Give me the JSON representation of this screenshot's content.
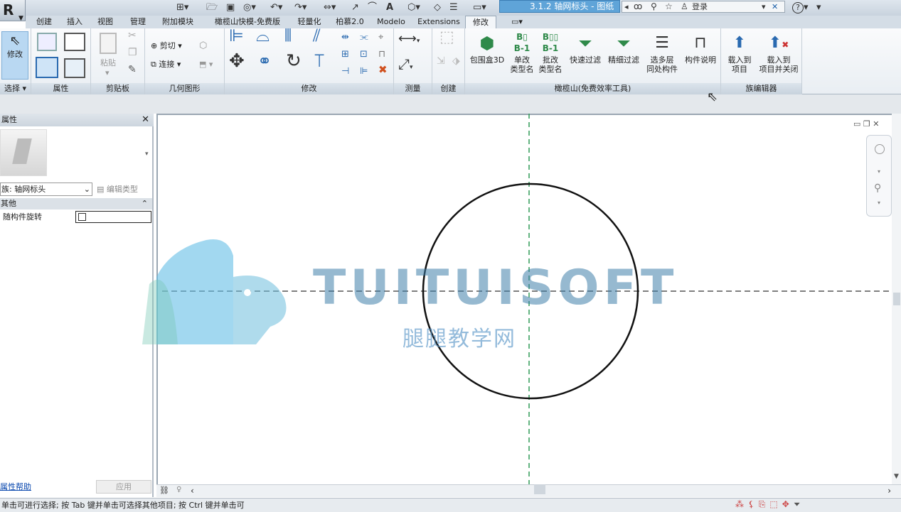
{
  "titlebar": {
    "app_icon": "revit-logo-icon",
    "app_letter": "R",
    "document_title": "3.1.2 轴网标头 - 图纸",
    "account_label": "登录",
    "help_label": "?"
  },
  "tabs": [
    "创建",
    "插入",
    "视图",
    "管理",
    "附加模块",
    "橄榄山快模-免费版",
    "轻量化",
    "柏慕2.0",
    "Modelo",
    "Extensions",
    "修改"
  ],
  "active_tab": "修改",
  "ribbon": {
    "panels": {
      "select": "选择",
      "properties": "属性",
      "clipboard": "剪贴板",
      "geometry": "几何图形",
      "modify": "修改",
      "measure": "测量",
      "create": "创建",
      "olivemountain": "橄榄山(免费效率工具)",
      "family_editor": "族编辑器"
    },
    "modify_button": "修改",
    "paste_label": "粘贴",
    "cut_label": "剪切",
    "join_label": "连接",
    "olive_buttons": [
      {
        "line1": "包围盒3D",
        "line2": ""
      },
      {
        "line1": "单改",
        "line2": "类型名"
      },
      {
        "line1": "批改",
        "line2": "类型名"
      },
      {
        "line1": "快速过滤",
        "line2": ""
      },
      {
        "line1": "精细过滤",
        "line2": ""
      },
      {
        "line1": "选多层",
        "line2": "同处构件"
      },
      {
        "line1": "构件说明",
        "line2": ""
      }
    ],
    "family_buttons": [
      {
        "line1": "载入到",
        "line2": "项目"
      },
      {
        "line1": "载入到",
        "line2": "项目并关闭"
      }
    ]
  },
  "properties": {
    "title": "属性",
    "family_type": "族: 轴网标头",
    "edit_type": "编辑类型",
    "group": "其他",
    "row_label": "随构件旋转",
    "row_checked": false,
    "help_link": "属性帮助",
    "apply": "应用"
  },
  "watermark": {
    "brand": "TUITUISOFT",
    "sub": "腿腿教学网"
  },
  "status_text": "单击可进行选择; 按 Tab 键并单击可选择其他项目; 按 Ctrl 键并单击可",
  "colors": {
    "accent_blue": "#5fa4d8",
    "grid_line_green": "#2e9a57",
    "ribbon_label_bg": "#c7d2dd"
  }
}
